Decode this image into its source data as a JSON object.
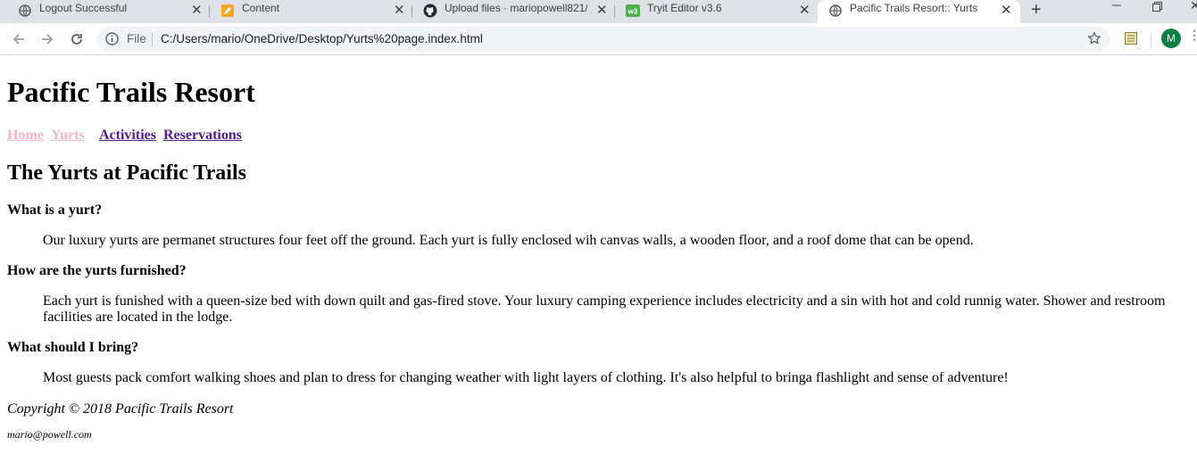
{
  "browser": {
    "tabs": [
      {
        "title": "Logout Successful",
        "icon": "globe-icon"
      },
      {
        "title": "Content",
        "icon": "pencil-icon"
      },
      {
        "title": "Upload files · mariopowell821/",
        "icon": "github-icon"
      },
      {
        "title": "Tryit Editor v3.6",
        "icon": "w3schools-icon"
      },
      {
        "title": "Pacific Trails Resort:: Yurts",
        "icon": "globe-icon"
      }
    ],
    "new_tab_label": "+",
    "address": {
      "scheme_label": "File",
      "url": "C:/Users/mario/OneDrive/Desktop/Yurts%20page.index.html"
    },
    "profile_initial": "M"
  },
  "page": {
    "site_title": "Pacific Trails Resort",
    "nav": [
      {
        "label": "Home"
      },
      {
        "label": "Yurts"
      },
      {
        "label": "Activities"
      },
      {
        "label": "Reservations"
      }
    ],
    "heading": "The Yurts at Pacific Trails",
    "faq": [
      {
        "question": "What is a yurt?",
        "answer": "Our luxury yurts are permanet structures four feet off the ground. Each yurt is fully enclosed wih canvas walls, a wooden floor, and a roof dome that can be opend."
      },
      {
        "question": "How are the yurts furnished?",
        "answer": "Each yurt is funished with a queen-size bed with down quilt and gas-fired stove. Your luxury camping experience includes electricity and a sin with hot and cold runnig water. Shower and restroom facilities are located in the lodge."
      },
      {
        "question": "What should I bring?",
        "answer": "Most guests pack comfort walking shoes and plan to dress for changing weather with light layers of clothing. It's also helpful to bringa flashlight and sense of adventure!"
      }
    ],
    "copyright": "Copyright © 2018 Pacific Trails Resort",
    "email": "mario@powell.com"
  }
}
